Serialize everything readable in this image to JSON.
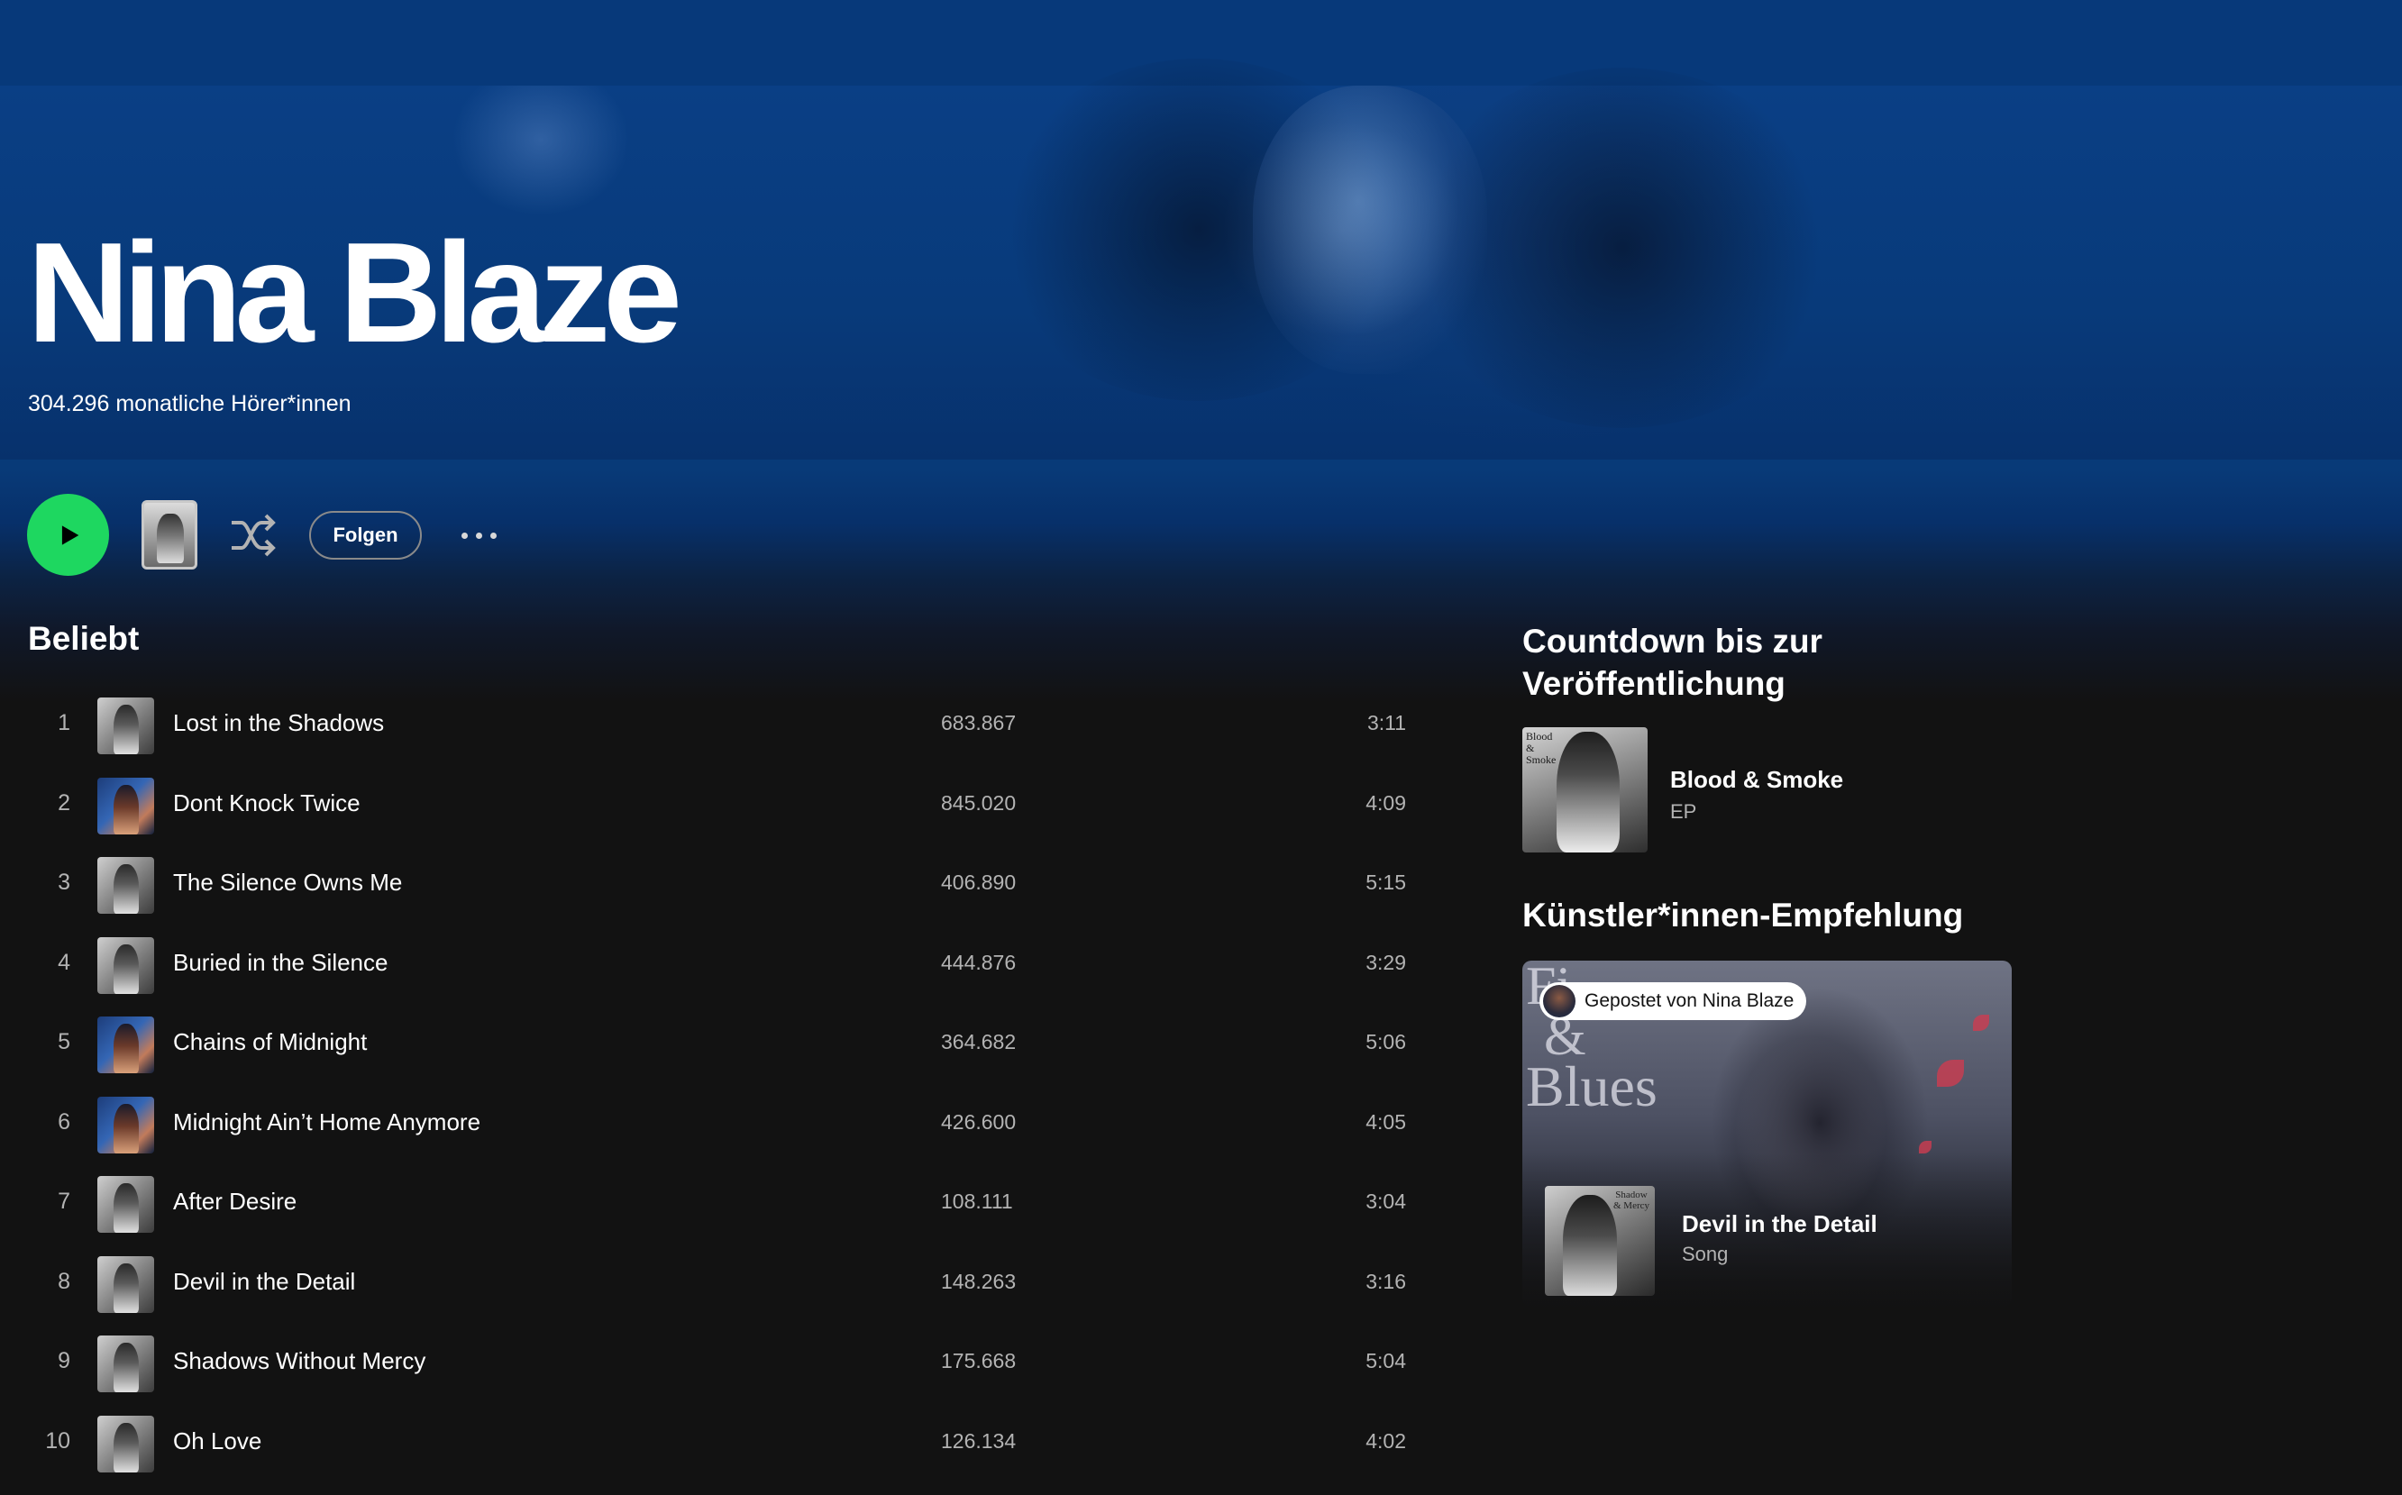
{
  "artist": {
    "name": "Nina Blaze",
    "monthly_listeners": "304.296 monatliche Hörer*innen"
  },
  "actions": {
    "play_icon": "play-icon",
    "shuffle_icon": "shuffle-icon",
    "follow_label": "Folgen",
    "more_icon": "more-icon"
  },
  "popular": {
    "title": "Beliebt",
    "tracks": [
      {
        "num": "1",
        "title": "Lost in the Shadows",
        "plays": "683.867",
        "duration": "3:11",
        "cover": "gray"
      },
      {
        "num": "2",
        "title": "Dont Knock Twice",
        "plays": "845.020",
        "duration": "4:09",
        "cover": "blue"
      },
      {
        "num": "3",
        "title": "The Silence Owns Me",
        "plays": "406.890",
        "duration": "5:15",
        "cover": "gray"
      },
      {
        "num": "4",
        "title": "Buried in the Silence",
        "plays": "444.876",
        "duration": "3:29",
        "cover": "gray"
      },
      {
        "num": "5",
        "title": "Chains of Midnight",
        "plays": "364.682",
        "duration": "5:06",
        "cover": "blue"
      },
      {
        "num": "6",
        "title": "Midnight Ain’t Home Anymore",
        "plays": "426.600",
        "duration": "4:05",
        "cover": "blue"
      },
      {
        "num": "7",
        "title": "After Desire",
        "plays": "108.111",
        "duration": "3:04",
        "cover": "gray"
      },
      {
        "num": "8",
        "title": "Devil in the Detail",
        "plays": "148.263",
        "duration": "3:16",
        "cover": "gray"
      },
      {
        "num": "9",
        "title": "Shadows Without Mercy",
        "plays": "175.668",
        "duration": "5:04",
        "cover": "gray"
      },
      {
        "num": "10",
        "title": "Oh Love",
        "plays": "126.134",
        "duration": "4:02",
        "cover": "gray"
      }
    ]
  },
  "countdown": {
    "title": "Countdown bis zur Veröffentlichung",
    "release_title": "Blood & Smoke",
    "release_type": "EP",
    "cover_text": "Blood & Smoke"
  },
  "artist_pick": {
    "title": "Künstler*innen-Empfehlung",
    "posted_by": "Gepostet von Nina Blaze",
    "art_line1": "Fi",
    "art_line2": "&",
    "art_line3": "Blues",
    "song_title": "Devil in the Detail",
    "song_type": "Song",
    "cover_text": "Shadow & Mercy"
  },
  "colors": {
    "accent_green": "#1ed760",
    "hero_blue": "#07397a",
    "background": "#121212",
    "muted_text": "#b3b3b3"
  }
}
